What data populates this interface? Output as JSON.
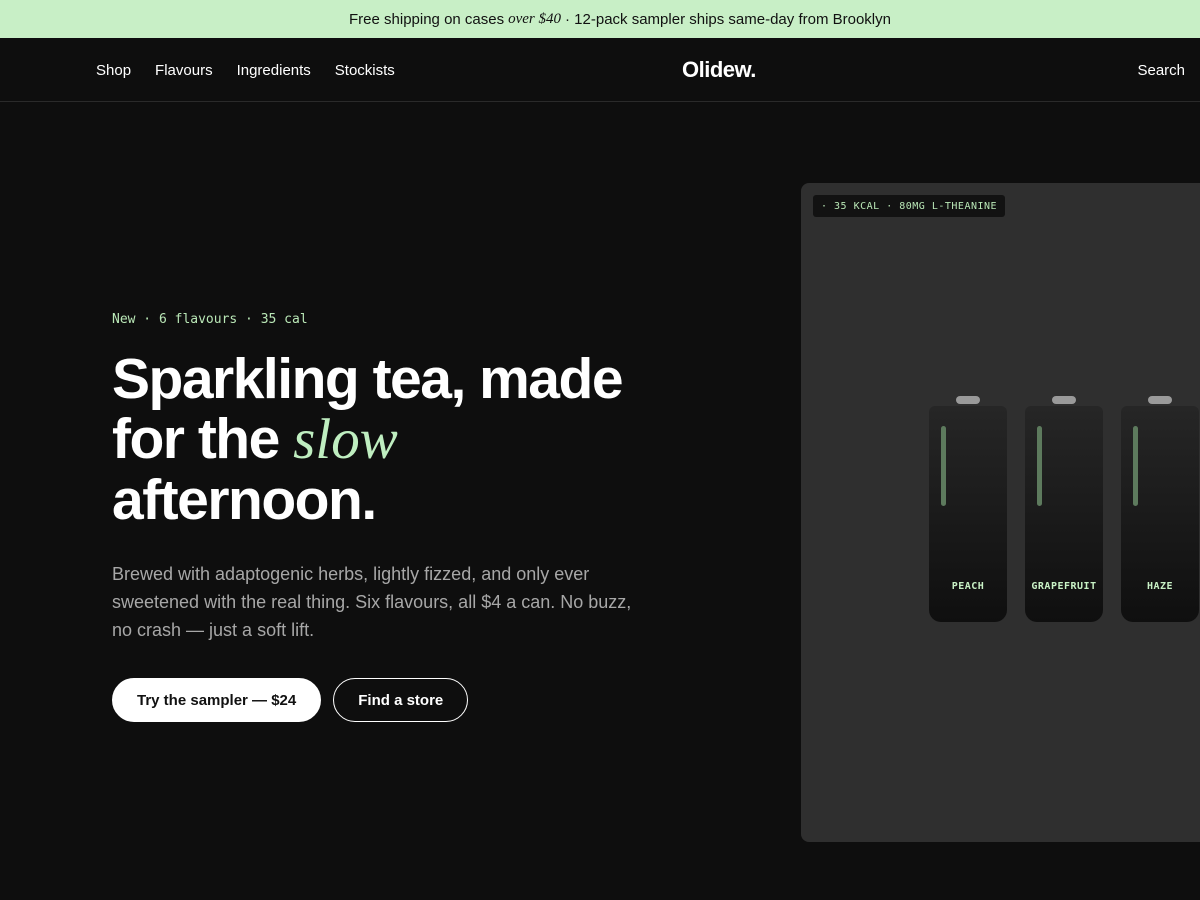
{
  "announcement": {
    "prefix": "Free shipping on cases",
    "emphasis": "over $40",
    "suffix": "· 12-pack sampler ships same-day from Brooklyn"
  },
  "nav": {
    "items": [
      "Shop",
      "Flavours",
      "Ingredients",
      "Stockists"
    ],
    "logo": "Olidew.",
    "search": "Search"
  },
  "hero": {
    "eyebrow": "New · 6 flavours · 35 cal",
    "title_line1": "Sparkling tea, made",
    "title_line2_prefix": "for the",
    "title_line2_em": "slow",
    "title_line3": "afternoon.",
    "description": "Brewed with adaptogenic herbs, lightly fizzed, and only ever sweetened with the real thing. Six flavours, all $4 a can. No buzz, no crash — just a soft lift.",
    "cta_primary": "Try the sampler — $24",
    "cta_secondary": "Find a store"
  },
  "panel": {
    "badge": "· 35 KCAL · 80MG L-THEANINE",
    "cans": [
      {
        "name": "PEACH"
      },
      {
        "name": "GRAPEFRUIT"
      },
      {
        "name": "HAZE"
      }
    ]
  },
  "colors": {
    "background": "#0e0e0e",
    "announcement_bg": "#c8efc6",
    "accent": "#bfeec0",
    "panel_bg": "#2f2f2f"
  }
}
